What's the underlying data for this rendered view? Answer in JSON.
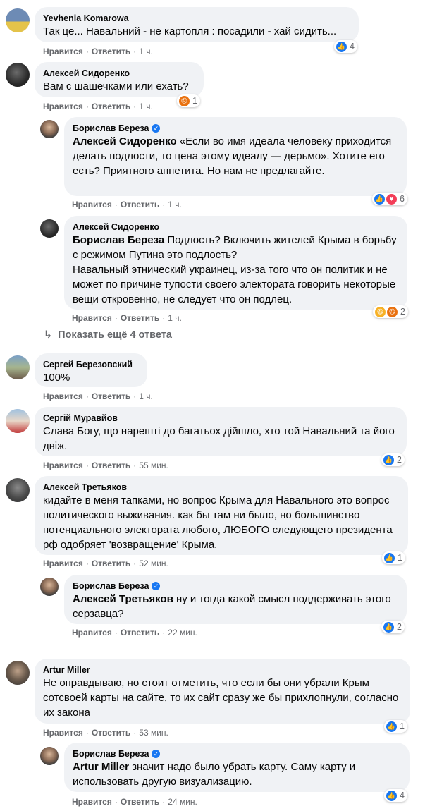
{
  "actions": {
    "like": "Нравится",
    "reply": "Ответить",
    "sep": "·"
  },
  "reactions": {
    "like": "like",
    "love": "love",
    "angry": "angry",
    "haha": "haha"
  },
  "comments": [
    {
      "name": "Yevhenia Komarowa",
      "text": "Так це... Навальний - не картопля : посадили - хай сидить...",
      "time": "1 ч.",
      "reaction_count": "4"
    },
    {
      "name": "Алексей Сидоренко",
      "text": "Вам с шашечками или ехать?",
      "time": "1 ч.",
      "reaction_count": "1",
      "replies": [
        {
          "name": "Борислав Береза",
          "mention": "Алексей Сидоренко",
          "text": " «Если во имя идеала человеку приходится делать подлости, то цена этому идеалу — дерьмо». Хотите его есть? Приятного аппетита. Но нам не предлагайте.",
          "time": "1 ч.",
          "reaction_count": "6"
        },
        {
          "name": "Алексей Сидоренко",
          "mention": "Борислав Береза",
          "text": " Подлость? Включить жителей Крыма в борьбу с режимом Путина это подлость?\nНавальный этнический украинец, из-за того что он политик и не может по причине тупости своего электората говорить некоторые вещи откровенно, не следует что он подлец.",
          "time": "1 ч.",
          "reaction_count": "2"
        }
      ],
      "show_more": "Показать ещё 4 ответа"
    },
    {
      "name": "Сергей Березовский",
      "text": "100%",
      "time": "1 ч."
    },
    {
      "name": "Сергій Муравйов",
      "text": "Слава Богу, що нарешті до багатьох дійшло, хто той Навальний та його двіж.",
      "time": "55 мин.",
      "reaction_count": "2"
    },
    {
      "name": "Алексей Третьяков",
      "text": "кидайте в меня тапками, но вопрос Крыма для Навального это вопрос политического выживания. как бы там ни было, но большинство потенциального электората любого, ЛЮБОГО следующего президента рф одобряет 'возвращение' Крыма.",
      "time": "52 мин.",
      "reaction_count": "1",
      "replies": [
        {
          "name": "Борислав Береза",
          "mention": "Алексей Третьяков",
          "text": " ну и тогда какой смысл поддерживать этого серзавца?",
          "time": "22 мин.",
          "reaction_count": "2"
        }
      ]
    },
    {
      "name": "Artur Miller",
      "text": "Не оправдываю, но стоит отметить, что если бы они убрали Крым сотсвоей карты на сайте, то их сайт сразу же бы прихлопнули, согласно их закона",
      "time": "53 мин.",
      "reaction_count": "1",
      "replies": [
        {
          "name": "Борислав Береза",
          "mention": "Artur Miller",
          "text": " значит надо было убрать карту. Саму карту и использовать другую визуализацию.",
          "time": "24 мин.",
          "reaction_count": "4"
        }
      ]
    }
  ]
}
